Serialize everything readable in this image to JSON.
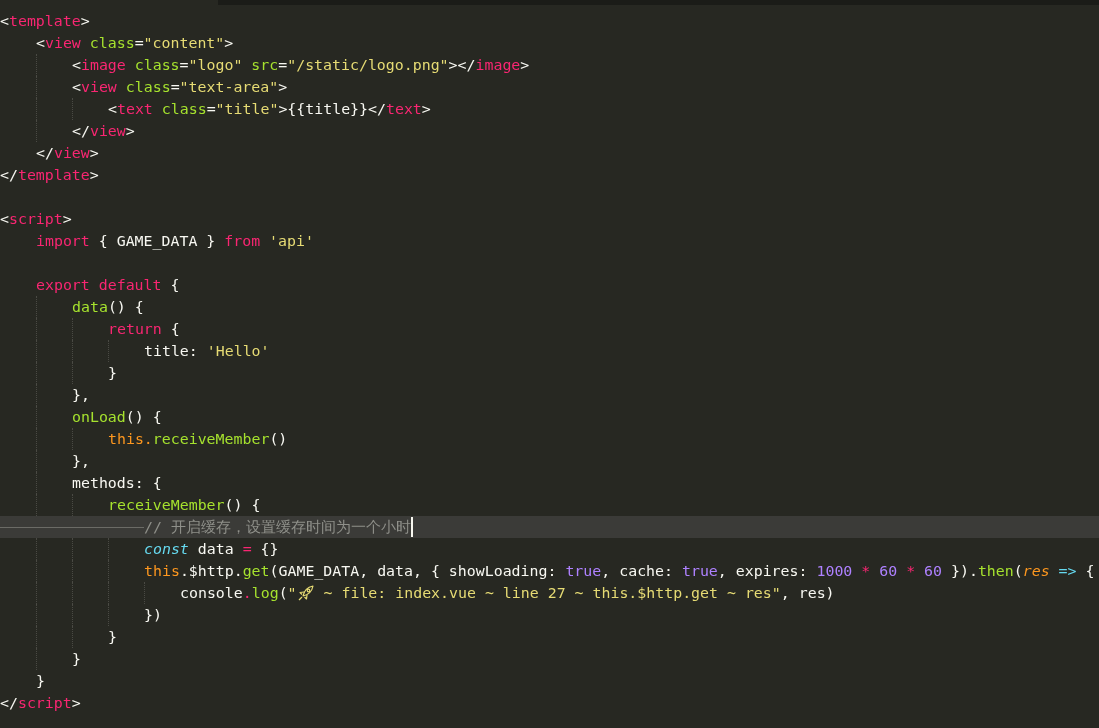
{
  "editor": {
    "lines": [
      {
        "kind": "code",
        "current": false,
        "tokens": [
          {
            "kind": "punct",
            "text": "<"
          },
          {
            "kind": "tag",
            "text": "template"
          },
          {
            "kind": "punct",
            "text": ">"
          }
        ],
        "children": [
          {
            "kind": "code",
            "current": false,
            "tokens": [
              {
                "kind": "punct",
                "text": "<"
              },
              {
                "kind": "tag",
                "text": "view"
              },
              {
                "kind": "attr",
                "text": " class"
              },
              {
                "kind": "punct",
                "text": "="
              },
              {
                "kind": "string",
                "text": "\"content\""
              },
              {
                "kind": "punct",
                "text": ">"
              }
            ],
            "children": [
              {
                "kind": "code",
                "current": false,
                "tokens": [
                  {
                    "kind": "punct",
                    "text": "<"
                  },
                  {
                    "kind": "tag",
                    "text": "image"
                  },
                  {
                    "kind": "attr",
                    "text": " class"
                  },
                  {
                    "kind": "punct",
                    "text": "="
                  },
                  {
                    "kind": "string",
                    "text": "\"logo\""
                  },
                  {
                    "kind": "attr",
                    "text": " src"
                  },
                  {
                    "kind": "punct",
                    "text": "="
                  },
                  {
                    "kind": "string",
                    "text": "\"/static/logo.png\""
                  },
                  {
                    "kind": "punct",
                    "text": "></"
                  },
                  {
                    "kind": "tag",
                    "text": "image"
                  },
                  {
                    "kind": "punct",
                    "text": ">"
                  }
                ]
              },
              {
                "kind": "code",
                "current": false,
                "tokens": [
                  {
                    "kind": "punct",
                    "text": "<"
                  },
                  {
                    "kind": "tag",
                    "text": "view"
                  },
                  {
                    "kind": "attr",
                    "text": " class"
                  },
                  {
                    "kind": "punct",
                    "text": "="
                  },
                  {
                    "kind": "string",
                    "text": "\"text-area\""
                  },
                  {
                    "kind": "punct",
                    "text": ">"
                  }
                ],
                "children": [
                  {
                    "kind": "code",
                    "current": false,
                    "tokens": [
                      {
                        "kind": "punct",
                        "text": "<"
                      },
                      {
                        "kind": "tag",
                        "text": "text"
                      },
                      {
                        "kind": "attr",
                        "text": " class"
                      },
                      {
                        "kind": "punct",
                        "text": "="
                      },
                      {
                        "kind": "string",
                        "text": "\"title\""
                      },
                      {
                        "kind": "punct",
                        "text": ">{{title}}</"
                      },
                      {
                        "kind": "tag",
                        "text": "text"
                      },
                      {
                        "kind": "punct",
                        "text": ">"
                      }
                    ]
                  }
                ]
              },
              {
                "kind": "code",
                "current": false,
                "tokens": [
                  {
                    "kind": "punct",
                    "text": "</"
                  },
                  {
                    "kind": "tag",
                    "text": "view"
                  },
                  {
                    "kind": "punct",
                    "text": ">"
                  }
                ]
              }
            ]
          },
          {
            "kind": "code",
            "current": false,
            "tokens": [
              {
                "kind": "punct",
                "text": "</"
              },
              {
                "kind": "tag",
                "text": "view"
              },
              {
                "kind": "punct",
                "text": ">"
              }
            ]
          }
        ]
      },
      {
        "kind": "code",
        "current": false,
        "tokens": [
          {
            "kind": "punct",
            "text": "</"
          },
          {
            "kind": "tag",
            "text": "template"
          },
          {
            "kind": "punct",
            "text": ">"
          }
        ]
      },
      {
        "kind": "blank"
      },
      {
        "kind": "code",
        "current": false,
        "tokens": [
          {
            "kind": "punct",
            "text": "<"
          },
          {
            "kind": "tag",
            "text": "script"
          },
          {
            "kind": "punct",
            "text": ">"
          }
        ],
        "children": [
          {
            "kind": "code",
            "current": false,
            "tokens": [
              {
                "kind": "keyword",
                "text": "import"
              },
              {
                "kind": "punct",
                "text": " { GAME_DATA } "
              },
              {
                "kind": "keyword",
                "text": "from"
              },
              {
                "kind": "string",
                "text": " 'api'"
              }
            ]
          },
          {
            "kind": "blank"
          },
          {
            "kind": "code",
            "current": false,
            "tokens": [
              {
                "kind": "keyword",
                "text": "export"
              },
              {
                "kind": "keyword",
                "text": " default"
              },
              {
                "kind": "punct",
                "text": " {"
              }
            ],
            "children": [
              {
                "kind": "code",
                "current": false,
                "tokens": [
                  {
                    "kind": "func",
                    "text": "data"
                  },
                  {
                    "kind": "punct",
                    "text": "() {"
                  }
                ],
                "children": [
                  {
                    "kind": "code",
                    "current": false,
                    "tokens": [
                      {
                        "kind": "keyword",
                        "text": "return"
                      },
                      {
                        "kind": "punct",
                        "text": " {"
                      }
                    ],
                    "children": [
                      {
                        "kind": "code",
                        "current": false,
                        "tokens": [
                          {
                            "kind": "punct",
                            "text": "title: "
                          },
                          {
                            "kind": "string",
                            "text": "'Hello'"
                          }
                        ]
                      }
                    ]
                  },
                  {
                    "kind": "code",
                    "current": false,
                    "tokens": [
                      {
                        "kind": "punct",
                        "text": "}"
                      }
                    ]
                  }
                ]
              },
              {
                "kind": "code",
                "current": false,
                "tokens": [
                  {
                    "kind": "punct",
                    "text": "},"
                  }
                ]
              },
              {
                "kind": "code",
                "current": false,
                "tokens": [
                  {
                    "kind": "func",
                    "text": "onLoad"
                  },
                  {
                    "kind": "punct",
                    "text": "() {"
                  }
                ],
                "children": [
                  {
                    "kind": "code",
                    "current": false,
                    "tokens": [
                      {
                        "kind": "this",
                        "text": "this."
                      },
                      {
                        "kind": "func",
                        "text": "receiveMember"
                      },
                      {
                        "kind": "punct",
                        "text": "()"
                      }
                    ]
                  }
                ]
              },
              {
                "kind": "code",
                "current": false,
                "tokens": [
                  {
                    "kind": "punct",
                    "text": "},"
                  }
                ]
              },
              {
                "kind": "code",
                "current": false,
                "tokens": [
                  {
                    "kind": "punct",
                    "text": "methods: {"
                  }
                ],
                "children": [
                  {
                    "kind": "code",
                    "current": false,
                    "tokens": [
                      {
                        "kind": "func",
                        "text": "receiveMember"
                      },
                      {
                        "kind": "punct",
                        "text": "() {"
                      }
                    ],
                    "children": [
                      {
                        "kind": "code",
                        "current": true,
                        "tokens": [
                          {
                            "kind": "comment",
                            "text": "// 开启缓存，设置缓存时间为一个小时"
                          }
                        ]
                      },
                      {
                        "kind": "code",
                        "current": false,
                        "tokens": [
                          {
                            "kind": "storage",
                            "text": "const"
                          },
                          {
                            "kind": "punct",
                            "text": " data "
                          },
                          {
                            "kind": "keyword",
                            "text": "="
                          },
                          {
                            "kind": "punct",
                            "text": " {}"
                          }
                        ]
                      },
                      {
                        "kind": "code",
                        "current": false,
                        "tokens": [
                          {
                            "kind": "this",
                            "text": "this"
                          },
                          {
                            "kind": "punct",
                            "text": ".$http."
                          },
                          {
                            "kind": "func",
                            "text": "get"
                          },
                          {
                            "kind": "punct",
                            "text": "(GAME_DATA, data, { showLoading: "
                          },
                          {
                            "kind": "number",
                            "text": "true"
                          },
                          {
                            "kind": "punct",
                            "text": ", cache: "
                          },
                          {
                            "kind": "number",
                            "text": "true"
                          },
                          {
                            "kind": "punct",
                            "text": ", expires: "
                          },
                          {
                            "kind": "number",
                            "text": "1000"
                          },
                          {
                            "kind": "keyword",
                            "text": " * "
                          },
                          {
                            "kind": "number",
                            "text": "60"
                          },
                          {
                            "kind": "keyword",
                            "text": " * "
                          },
                          {
                            "kind": "number",
                            "text": "60"
                          },
                          {
                            "kind": "punct",
                            "text": " })."
                          },
                          {
                            "kind": "func",
                            "text": "then"
                          },
                          {
                            "kind": "punct",
                            "text": "("
                          },
                          {
                            "kind": "param",
                            "text": "res"
                          },
                          {
                            "kind": "storage",
                            "text": " =>"
                          },
                          {
                            "kind": "punct",
                            "text": " {"
                          }
                        ],
                        "children": [
                          {
                            "kind": "code",
                            "current": false,
                            "tokens": [
                              {
                                "kind": "punct",
                                "text": "console"
                              },
                              {
                                "kind": "keyword",
                                "text": "."
                              },
                              {
                                "kind": "func",
                                "text": "log"
                              },
                              {
                                "kind": "punct",
                                "text": "("
                              },
                              {
                                "kind": "string",
                                "text": "\""
                              },
                              {
                                "kind": "rocket"
                              },
                              {
                                "kind": "string",
                                "text": " ~ file: index.vue ~ line 27 ~ this.$http.get ~ res\""
                              },
                              {
                                "kind": "punct",
                                "text": ", res)"
                              }
                            ]
                          }
                        ]
                      },
                      {
                        "kind": "code",
                        "current": false,
                        "tokens": [
                          {
                            "kind": "punct",
                            "text": "})"
                          }
                        ]
                      }
                    ]
                  },
                  {
                    "kind": "code",
                    "current": false,
                    "tokens": [
                      {
                        "kind": "punct",
                        "text": "}"
                      }
                    ]
                  }
                ]
              },
              {
                "kind": "code",
                "current": false,
                "tokens": [
                  {
                    "kind": "punct",
                    "text": "}"
                  }
                ]
              }
            ]
          },
          {
            "kind": "code",
            "current": false,
            "tokens": [
              {
                "kind": "punct",
                "text": "}"
              }
            ]
          }
        ]
      },
      {
        "kind": "code",
        "current": false,
        "tokens": [
          {
            "kind": "punct",
            "text": "</"
          },
          {
            "kind": "tag",
            "text": "script"
          },
          {
            "kind": "punct",
            "text": ">"
          }
        ]
      }
    ]
  }
}
